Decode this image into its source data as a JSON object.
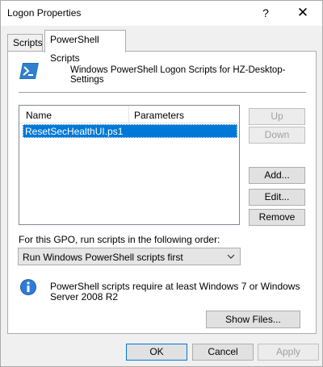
{
  "window": {
    "title": "Logon Properties",
    "help_glyph": "?",
    "close_glyph": "✕"
  },
  "tabs": [
    {
      "label": "Scripts",
      "active": false
    },
    {
      "label": "PowerShell Scripts",
      "active": true
    }
  ],
  "panel": {
    "header": "Windows PowerShell Logon Scripts for HZ-Desktop-Settings",
    "icon": "powershell-icon",
    "list": {
      "columns": [
        "Name",
        "Parameters"
      ],
      "rows": [
        {
          "name": "ResetSecHealthUI.ps1",
          "parameters": "",
          "selected": true
        }
      ]
    },
    "buttons": {
      "up": "Up",
      "down": "Down",
      "add": "Add...",
      "edit": "Edit...",
      "remove": "Remove"
    },
    "order_label": "For this GPO, run scripts in the following order:",
    "order_value": "Run Windows PowerShell scripts first",
    "info_text": "PowerShell scripts require at least Windows 7 or Windows Server 2008 R2",
    "show_files": "Show Files..."
  },
  "footer": {
    "ok": "OK",
    "cancel": "Cancel",
    "apply": "Apply"
  },
  "colors": {
    "selection": "#0078d7",
    "panel_bg": "#ffffff",
    "dialog_bg": "#f0f0f0"
  }
}
